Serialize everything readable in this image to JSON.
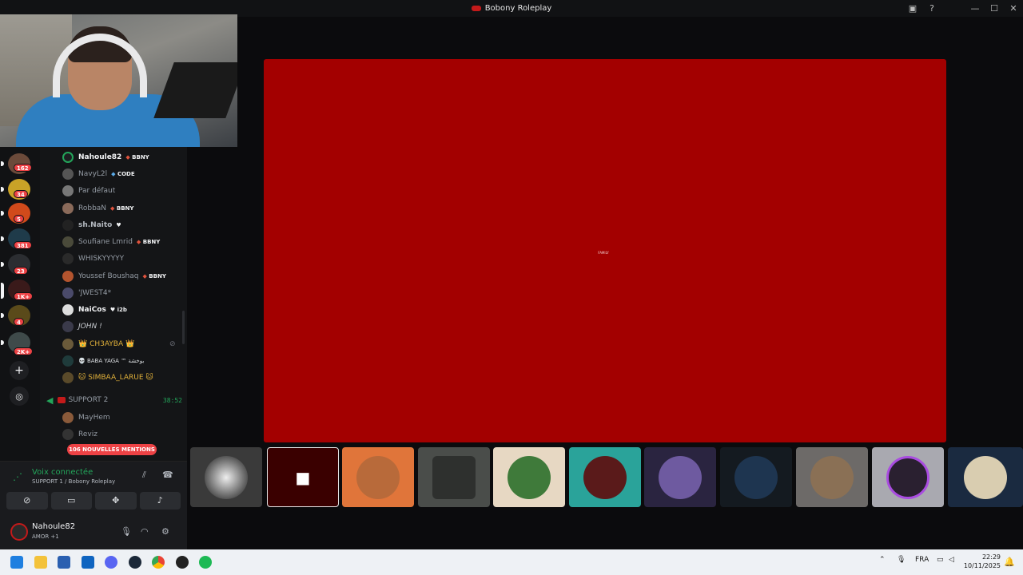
{
  "window": {
    "title": "Bobony Roleplay"
  },
  "colors": {
    "accent_red": "#a30000",
    "voice_green": "#23a55a",
    "mention_red": "#ed4245"
  },
  "server_rail": {
    "badges": [
      "162",
      "34",
      "5",
      "381",
      "23",
      "1K+",
      "4",
      "2K+"
    ],
    "add_icon": "+",
    "discover_icon": "compass-icon"
  },
  "members": [
    {
      "name": "Nahoule82",
      "tag": "BBNY",
      "tag_type": "red"
    },
    {
      "name": "NavyL2l",
      "tag": "CODE",
      "tag_type": "blue"
    },
    {
      "name": "Par défaut",
      "tag": ""
    },
    {
      "name": "RobbaN",
      "tag": "BBNY",
      "tag_type": "red"
    },
    {
      "name": "sh.Naito",
      "tag": "",
      "tag_type": "heart"
    },
    {
      "name": "Soufiane Lmrid",
      "tag": "BBNY",
      "tag_type": "red"
    },
    {
      "name": "WHISKYYYYY",
      "tag": ""
    },
    {
      "name": "Youssef Boushaq",
      "tag": "BBNY",
      "tag_type": "red"
    },
    {
      "name": "'JWEST4*",
      "tag": ""
    },
    {
      "name": "NaiCos",
      "tag": "i2b",
      "tag_type": "heart"
    },
    {
      "name": "JOHN !",
      "tag": ""
    },
    {
      "name": "👑 CH3AYBA 👑",
      "tag": ""
    },
    {
      "name": "💀 BABA YAGA ™ بوخشة",
      "tag": ""
    },
    {
      "name": "🐱 SIMBAA_LARUE 🐱",
      "tag": ""
    }
  ],
  "voice_channel": {
    "name": "SUPPORT 2",
    "duration": "38:52"
  },
  "channel_members": [
    "MayHem",
    "Reviz"
  ],
  "mentions_banner": "106 NOUVELLES MENTIONS",
  "voice_panel": {
    "status": "Voix connectée",
    "location": "SUPPORT 1 / Bobony Roleplay"
  },
  "user": {
    "name": "Nahoule82",
    "status": "AMOR +1"
  },
  "stage": {
    "watermark": "FAMILY"
  },
  "taskbar": {
    "language": "FRA",
    "time": "22:29",
    "date": "10/11/2025"
  }
}
